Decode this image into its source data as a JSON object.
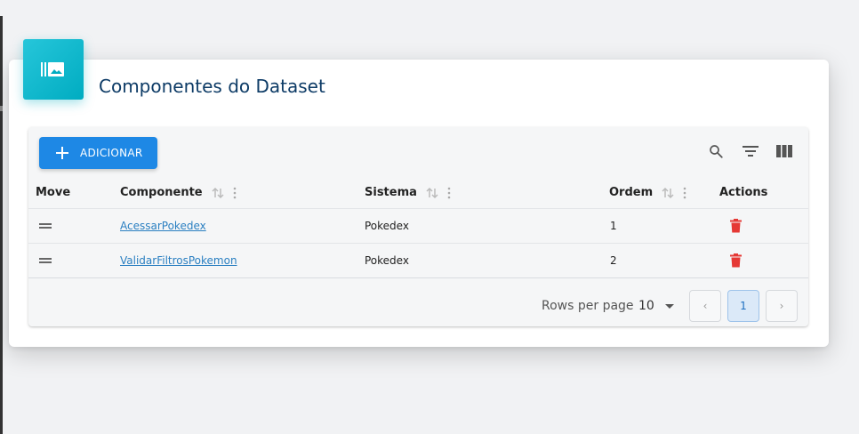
{
  "card": {
    "title": "Componentes do Dataset",
    "icon": "collections-icon",
    "accent_color": "#00acc1"
  },
  "toolbar": {
    "add_label": "ADICIONAR",
    "search_icon": "search-icon",
    "filter_icon": "filter-icon",
    "columns_icon": "columns-icon"
  },
  "table": {
    "headers": {
      "move": "Move",
      "componente": "Componente",
      "sistema": "Sistema",
      "ordem": "Ordem",
      "actions": "Actions"
    },
    "rows": [
      {
        "componente": "AcessarPokedex",
        "sistema": "Pokedex",
        "ordem": "1"
      },
      {
        "componente": "ValidarFiltrosPokemon",
        "sistema": "Pokedex",
        "ordem": "2"
      }
    ],
    "delete_color": "#e53935"
  },
  "pagination": {
    "rows_per_page_label": "Rows per page",
    "rows_per_page_value": "10",
    "current_page": "1",
    "prev_symbol": "‹",
    "next_symbol": "›"
  }
}
